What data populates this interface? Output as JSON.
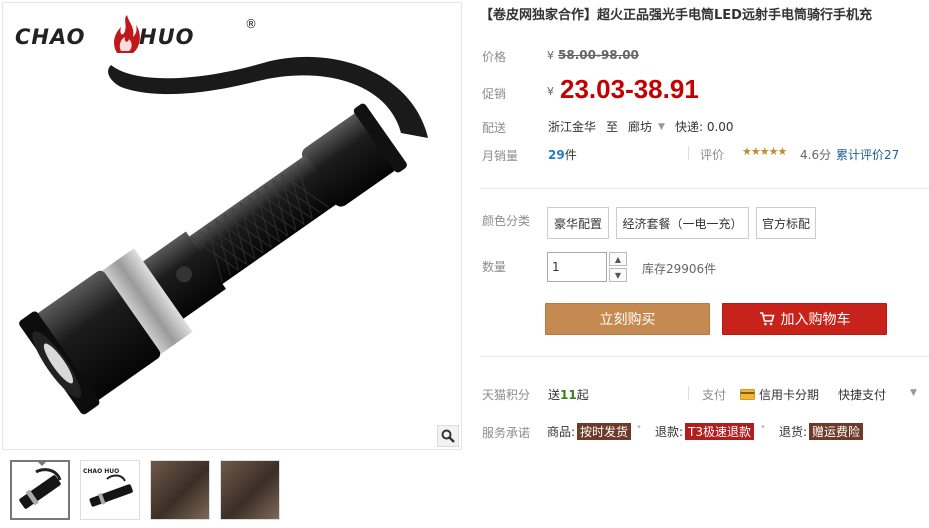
{
  "logo": {
    "left": "CHAO",
    "right": "HUO",
    "reg": "®"
  },
  "title": {
    "brand_tag": "【卷皮网独家合作】",
    "text": "超火正品强光手电筒LED远射手电筒骑行手机充"
  },
  "price": {
    "label": "价格",
    "currency": "¥",
    "value": "58.00-98.00"
  },
  "promo": {
    "label": "促销",
    "currency": "¥",
    "value": "23.03-38.91"
  },
  "shipping": {
    "label": "配送",
    "from": "浙江金华",
    "to_word": "至",
    "to": "廊坊",
    "fee": "快递: 0.00"
  },
  "sales": {
    "label": "月销量",
    "count": "29",
    "unit": "件"
  },
  "reviews": {
    "label": "评价",
    "stars": "★★★★★",
    "score": "4.6分",
    "cumulative": "累计评价27"
  },
  "color": {
    "label": "颜色分类",
    "options": [
      "豪华配置",
      "经济套餐（一电一充）",
      "官方标配"
    ]
  },
  "quantity": {
    "label": "数量",
    "value": "1",
    "stock": "库存29906件"
  },
  "buttons": {
    "buy": "立刻购买",
    "cart": "加入购物车"
  },
  "points": {
    "label": "天猫积分",
    "prefix": "送",
    "value": "11",
    "suffix": "起"
  },
  "payment": {
    "label": "支付",
    "card": "信用卡分期",
    "quick": "快捷支付"
  },
  "service": {
    "label": "服务承诺",
    "items": [
      {
        "prefix": "商品:",
        "tag": "按时发货"
      },
      {
        "prefix": "退款:",
        "tag": "T3极速退款"
      },
      {
        "prefix": "退货:",
        "tag": "赠运费险"
      }
    ]
  },
  "colors": {
    "promo_red": "#c40000",
    "buy_btn": "#c58a52",
    "cart_btn": "#c7231b",
    "link_blue": "#1d5e9a"
  }
}
